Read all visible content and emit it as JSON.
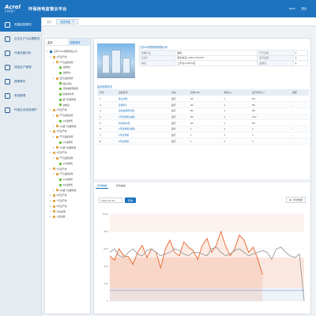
{
  "app": {
    "logo_main": "Acrel",
    "logo_sub": "安科瑞电气",
    "title": "环保用电监管云平台",
    "user": "acrel",
    "logout": "退出"
  },
  "sidebar": {
    "items": [
      {
        "label": "设备监控概况",
        "active": true
      },
      {
        "label": "企业生产与治理概况",
        "active": false
      },
      {
        "label": "环保设备分析",
        "active": false
      },
      {
        "label": "排放生产管理",
        "active": false
      },
      {
        "label": "报警事件",
        "active": false
      },
      {
        "label": "系统管理",
        "active": false
      },
      {
        "label": "环保企业信息维护",
        "active": false
      }
    ]
  },
  "breadcrumb": {
    "home": "首页",
    "tab": "检查导航"
  },
  "left_panel": {
    "tabs": [
      "监测",
      "设备选择"
    ],
    "tree": [
      {
        "label": "江苏XXXX管理有限公司",
        "level": 0,
        "color": "#1e73be"
      },
      {
        "label": "1号生产线",
        "level": 1,
        "color": "#e6a23c"
      },
      {
        "label": "产污设施监测",
        "level": 2,
        "color": "#e6a23c"
      },
      {
        "label": "注塑机1",
        "level": 3,
        "color": "#67c23a"
      },
      {
        "label": "注塑机2",
        "level": 3,
        "color": "#67c23a"
      },
      {
        "label": "治污设施监测",
        "level": 2,
        "color": "#e6a23c"
      },
      {
        "label": "除尘风机",
        "level": 3,
        "color": "#67c23a"
      },
      {
        "label": "活性炭吸附装置",
        "level": 3,
        "color": "#67c23a"
      },
      {
        "label": "喷淋塔水泵",
        "level": 3,
        "color": "#67c23a"
      },
      {
        "label": "废气处理风机",
        "level": 3,
        "color": "#67c23a"
      },
      {
        "label": "总电表",
        "level": 3,
        "color": "#67c23a"
      },
      {
        "label": "2号生产线",
        "level": 1,
        "color": "#e6a23c"
      },
      {
        "label": "产污设施监测",
        "level": 2,
        "color": "#e6a23c"
      },
      {
        "label": "1#注塑机",
        "level": 3,
        "color": "#67c23a"
      },
      {
        "label": "2#废气处理风机",
        "level": 2,
        "color": "#e6a23c"
      },
      {
        "label": "3号生产线",
        "level": 1,
        "color": "#e6a23c"
      },
      {
        "label": "产污设施监测",
        "level": 2,
        "color": "#e6a23c"
      },
      {
        "label": "1#注塑机",
        "level": 3,
        "color": "#67c23a"
      },
      {
        "label": "3#废气处理风机",
        "level": 2,
        "color": "#e6a23c"
      },
      {
        "label": "4号生产线",
        "level": 1,
        "color": "#e6a23c"
      },
      {
        "label": "产污设施监测",
        "level": 2,
        "color": "#e6a23c"
      },
      {
        "label": "1#注塑机",
        "level": 3,
        "color": "#67c23a"
      },
      {
        "label": "5号生产线",
        "level": 1,
        "color": "#e6a23c"
      },
      {
        "label": "产污设施监测",
        "level": 2,
        "color": "#e6a23c"
      },
      {
        "label": "1#注塑机",
        "level": 3,
        "color": "#67c23a"
      },
      {
        "label": "2#注塑机",
        "level": 3,
        "color": "#67c23a"
      },
      {
        "label": "5#废气处理风机",
        "level": 2,
        "color": "#e6a23c"
      },
      {
        "label": "6号生产线",
        "level": 1,
        "color": "#e6a23c"
      },
      {
        "label": "7号生产线",
        "level": 1,
        "color": "#e6a23c"
      },
      {
        "label": "8号生产线",
        "level": 1,
        "color": "#e6a23c"
      },
      {
        "label": "污水处理",
        "level": 1,
        "color": "#e6a23c"
      },
      {
        "label": "公用设施",
        "level": 1,
        "color": "#e6a23c"
      }
    ]
  },
  "company": {
    "title": "江苏XX有限管理有限公司",
    "rows": [
      [
        "所属行业",
        "塑料",
        "产污设施",
        "6"
      ],
      [
        "负责人",
        "联系电话 13812345678",
        "治污设施",
        "4"
      ],
      [
        "地址",
        "江苏省XX市XX区",
        "监测点",
        "6"
      ]
    ]
  },
  "device_table": {
    "label": "监测设施情况",
    "headers": [
      "序号",
      "设施名称",
      "状态",
      "功率(kW)",
      "电流(A)",
      "运行时长(h)",
      "报警"
    ],
    "rows": [
      [
        "1",
        "除尘风机",
        "运行",
        "40",
        "1",
        "80",
        "-"
      ],
      [
        "2",
        "注塑机1",
        "运行",
        "40",
        "1",
        "80",
        "-"
      ],
      [
        "3",
        "活性炭吸附装置",
        "运行",
        "80",
        "1",
        "80",
        "-"
      ],
      [
        "4",
        "2号注塑机(油泵)",
        "运行",
        "80",
        "1",
        "270",
        "-"
      ],
      [
        "5",
        "喷淋塔水泵",
        "运行",
        "40",
        "1",
        "80",
        "-"
      ],
      [
        "6",
        "3号注塑机(油泵)",
        "运行",
        "1",
        "1",
        "1",
        "-"
      ],
      [
        "7",
        "5号注塑机",
        "运行",
        "1",
        "1",
        "1",
        "-"
      ],
      [
        "8",
        "6号注塑机",
        "运行",
        "1",
        "1",
        "1",
        "-"
      ]
    ]
  },
  "chart_tabs": [
    "实时数据",
    "历史曲线"
  ],
  "date_value": "2019-01-01",
  "query_label": "查询",
  "export_label": "导出数据",
  "chart_data": {
    "type": "line",
    "ylim": [
      0,
      1000
    ],
    "yticks": [
      "1000",
      "800",
      "600",
      "400",
      "200",
      "0"
    ],
    "series": [
      {
        "color": "#e8622c",
        "values": [
          520,
          470,
          600,
          520,
          510,
          420,
          560,
          640,
          500,
          600,
          560,
          380,
          600,
          700,
          560,
          520,
          680,
          620,
          580,
          480,
          640,
          720,
          560,
          640,
          800,
          640,
          520,
          600,
          760,
          700,
          560,
          620,
          480,
          300,
          null,
          null,
          null,
          null,
          null,
          null,
          null,
          null,
          null
        ]
      },
      {
        "color": "#9a9a9a",
        "values": [
          560,
          600,
          520,
          500,
          560,
          600,
          540,
          520,
          580,
          600,
          560,
          520,
          540,
          560,
          600,
          580,
          540,
          520,
          560,
          560,
          540,
          520,
          600,
          620,
          560,
          520,
          540,
          580,
          600,
          560,
          520,
          540,
          560,
          580,
          560,
          480,
          600,
          620,
          560,
          520,
          500,
          540,
          0
        ]
      }
    ]
  },
  "colors": {
    "brand": "#1e73be",
    "sidebar_bg": "#e4ebf1",
    "orange_series": "#e8622c",
    "gray_series": "#9a9a9a"
  }
}
